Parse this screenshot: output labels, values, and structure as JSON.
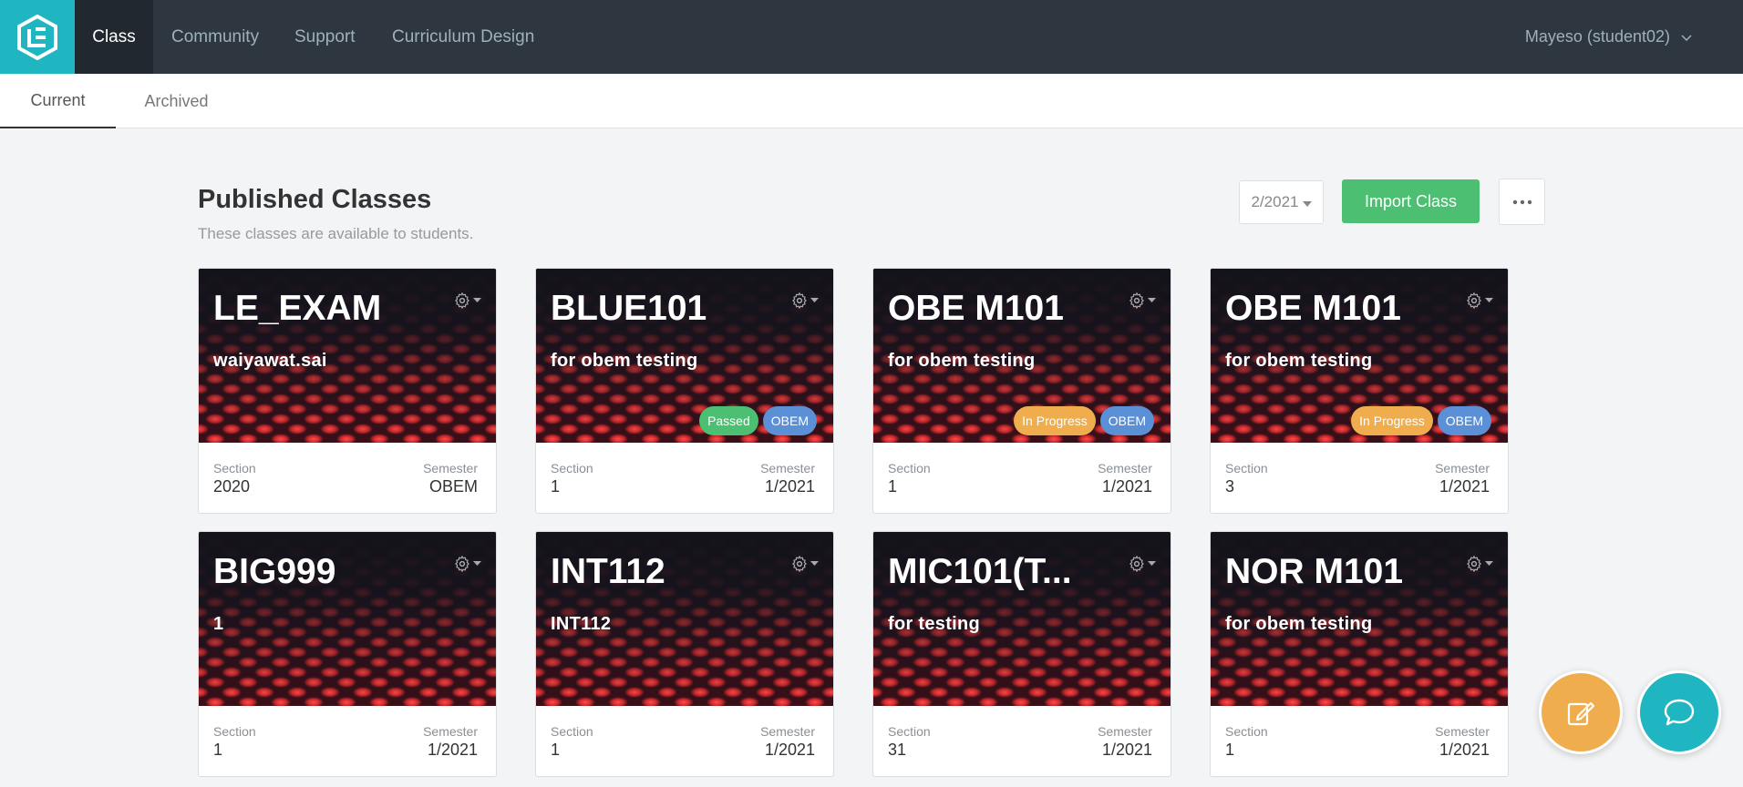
{
  "nav": {
    "items": [
      "Class",
      "Community",
      "Support",
      "Curriculum Design"
    ],
    "user": "Mayeso (student02)"
  },
  "tabs": [
    "Current",
    "Archived"
  ],
  "header": {
    "title": "Published Classes",
    "subtitle": "These classes are available to students.",
    "semester": "2/2021",
    "import_label": "Import Class"
  },
  "labels": {
    "section": "Section",
    "semester": "Semester"
  },
  "cards": [
    {
      "title": "LE_EXAM",
      "subtitle": "waiyawat.sai",
      "section": "2020",
      "semester": "OBEM",
      "badges": []
    },
    {
      "title": "BLUE101",
      "subtitle": "for obem testing",
      "section": "1",
      "semester": "1/2021",
      "badges": [
        "Passed",
        "OBEM"
      ]
    },
    {
      "title": "OBE M101",
      "subtitle": "for obem testing",
      "section": "1",
      "semester": "1/2021",
      "badges": [
        "In Progress",
        "OBEM"
      ]
    },
    {
      "title": "OBE M101",
      "subtitle": "for obem testing",
      "section": "3",
      "semester": "1/2021",
      "badges": [
        "In Progress",
        "OBEM"
      ]
    },
    {
      "title": "BIG999",
      "subtitle": "1",
      "section": "1",
      "semester": "1/2021",
      "badges": []
    },
    {
      "title": "INT112",
      "subtitle": "INT112",
      "section": "1",
      "semester": "1/2021",
      "badges": []
    },
    {
      "title": "MIC101(T...",
      "subtitle": "for testing",
      "section": "31",
      "semester": "1/2021",
      "badges": []
    },
    {
      "title": "NOR M101",
      "subtitle": "for obem testing",
      "section": "1",
      "semester": "1/2021",
      "badges": []
    }
  ],
  "colors": {
    "nav_bg": "#2e3640",
    "brand": "#1fb6c1",
    "success": "#4cbf72",
    "warning": "#f0ad4e",
    "info": "#5b8fd6"
  },
  "icons": [
    "logo-icon",
    "chevron-down-icon",
    "more-icon",
    "gear-icon",
    "edit-icon",
    "chat-icon"
  ]
}
